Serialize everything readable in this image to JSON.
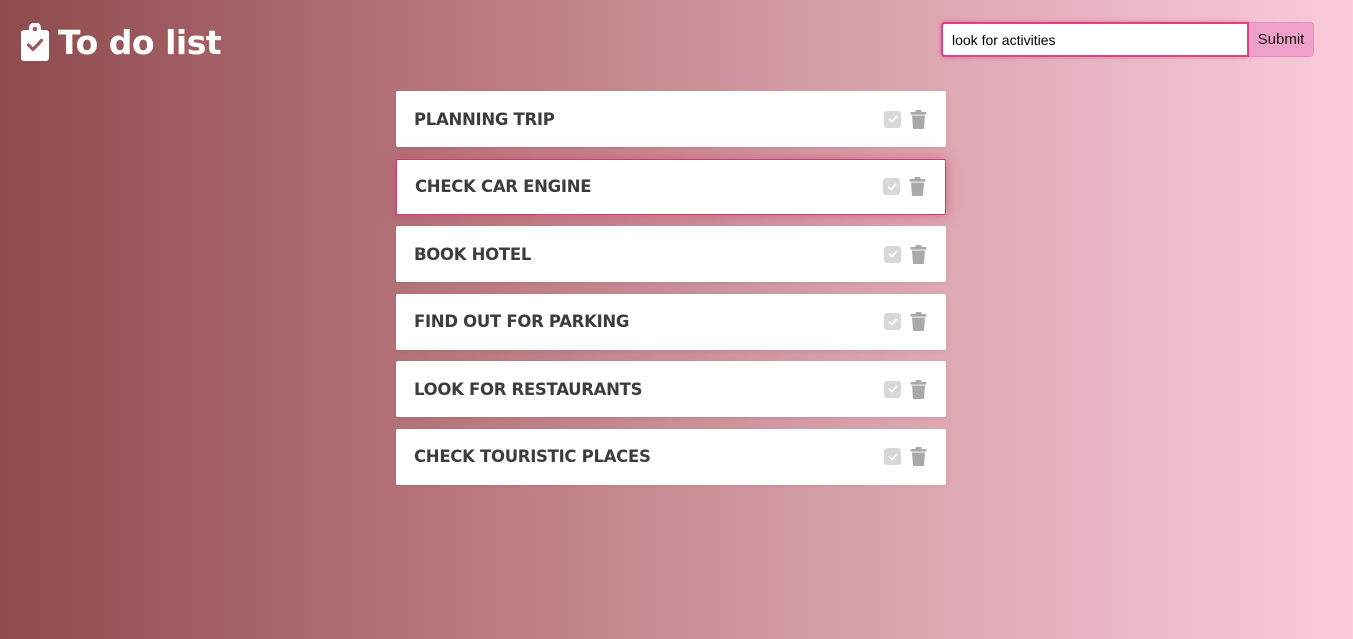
{
  "header": {
    "title": "To do list",
    "logo_icon": "clipboard-check-icon"
  },
  "search": {
    "value": "look for activities",
    "submit_label": "Submit",
    "accent_color": "#e0427f"
  },
  "todos": [
    {
      "text": "PLANNING TRIP",
      "active": false
    },
    {
      "text": "CHECK CAR ENGINE",
      "active": true
    },
    {
      "text": "BOOK HOTEL",
      "active": false
    },
    {
      "text": "FIND OUT FOR PARKING",
      "active": false
    },
    {
      "text": "LOOK FOR RESTAURANTS",
      "active": false
    },
    {
      "text": "CHECK TOURISTIC PLACES",
      "active": false
    }
  ],
  "icons": {
    "complete": "check-square-icon",
    "delete": "trash-icon"
  },
  "colors": {
    "background_start": "#8e4b4e",
    "background_end": "#fbcbdb",
    "item_text": "#3d3d3d",
    "icon_gray": "#a9a9a9"
  }
}
